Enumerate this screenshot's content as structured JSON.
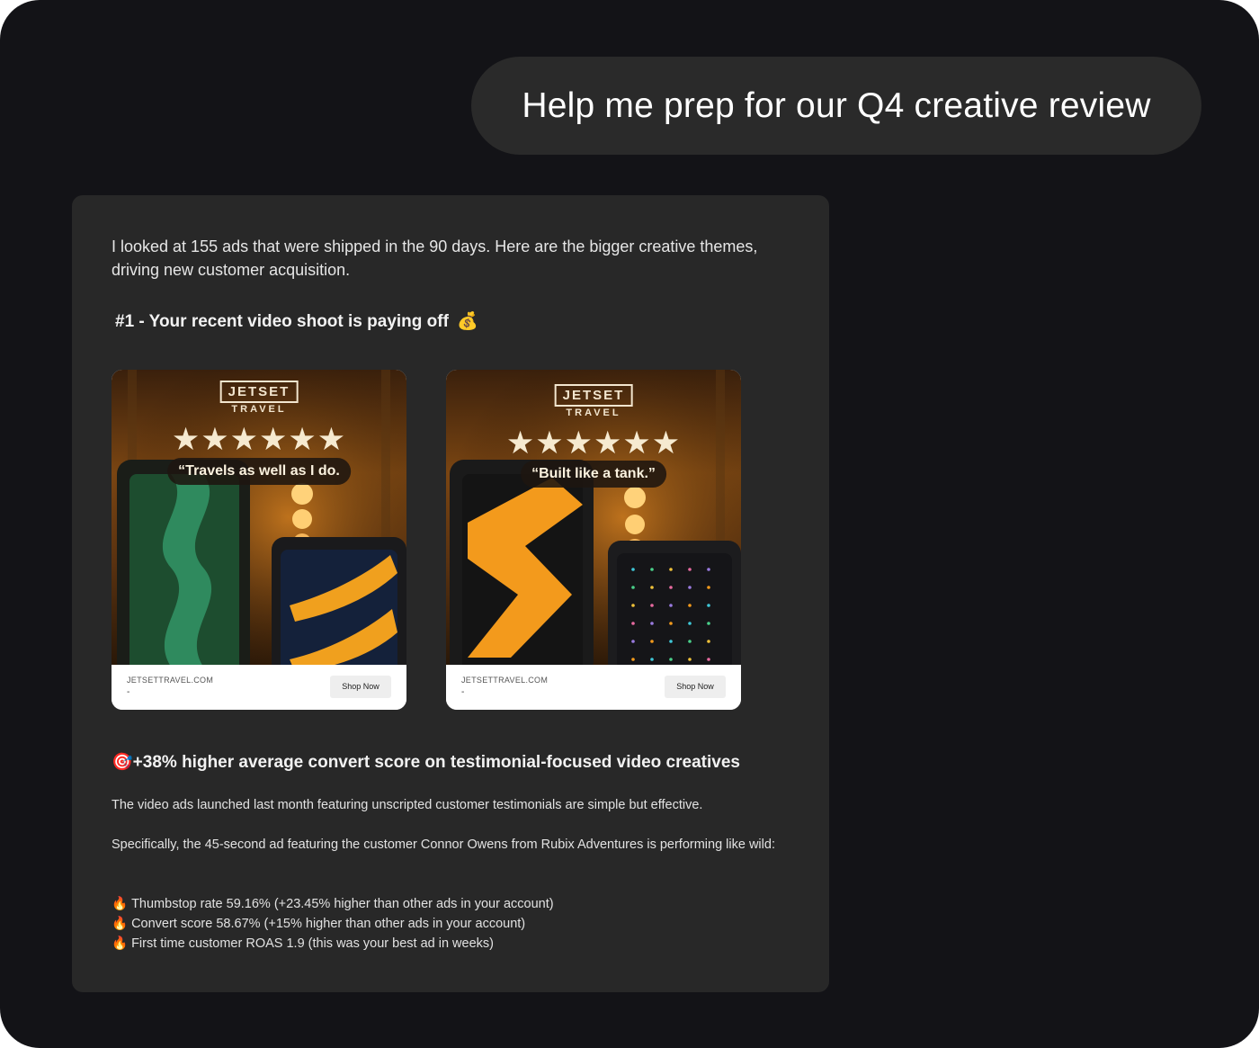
{
  "user_message": "Help me prep for our Q4 creative review",
  "reply": {
    "intro": "I looked at 155 ads that were shipped in the 90 days. Here are the bigger creative themes, driving new customer acquisition.",
    "theme1_heading": "#1 - Your recent video shoot is paying off",
    "theme1_emoji": "💰",
    "ads": [
      {
        "brand": "JETSET",
        "brand_sub": "TRAVEL",
        "stars": "★★★★★★",
        "quote": "“Travels as well as I do.",
        "domain": "JETSETTRAVEL.COM",
        "dash": "-",
        "cta": "Shop Now"
      },
      {
        "brand": "JETSET",
        "brand_sub": "TRAVEL",
        "stars": "★★★★★★",
        "quote": "“Built like a tank.”",
        "domain": "JETSETTRAVEL.COM",
        "dash": "-",
        "cta": "Shop Now"
      }
    ],
    "stat_emoji": "🎯",
    "stat_heading": "+38% higher average convert score on testimonial-focused video creatives",
    "paragraph1": "The video ads launched last month featuring unscripted customer testimonials are simple but effective.",
    "paragraph2": "Specifically, the 45-second ad featuring the customer Connor Owens from Rubix Adventures is performing like wild:",
    "bullet_emoji": "🔥",
    "bullets": [
      "Thumbstop rate 59.16% (+23.45% higher than other ads in your account)",
      "Convert score 58.67% (+15% higher than other ads in your account)",
      "First time customer ROAS 1.9 (this was your best ad in weeks)"
    ]
  },
  "colors": {
    "background": "#131317",
    "bubble": "#2a2a2a",
    "card": "#282828",
    "accent_orange": "#f39a1c",
    "accent_green": "#1f7a52"
  }
}
